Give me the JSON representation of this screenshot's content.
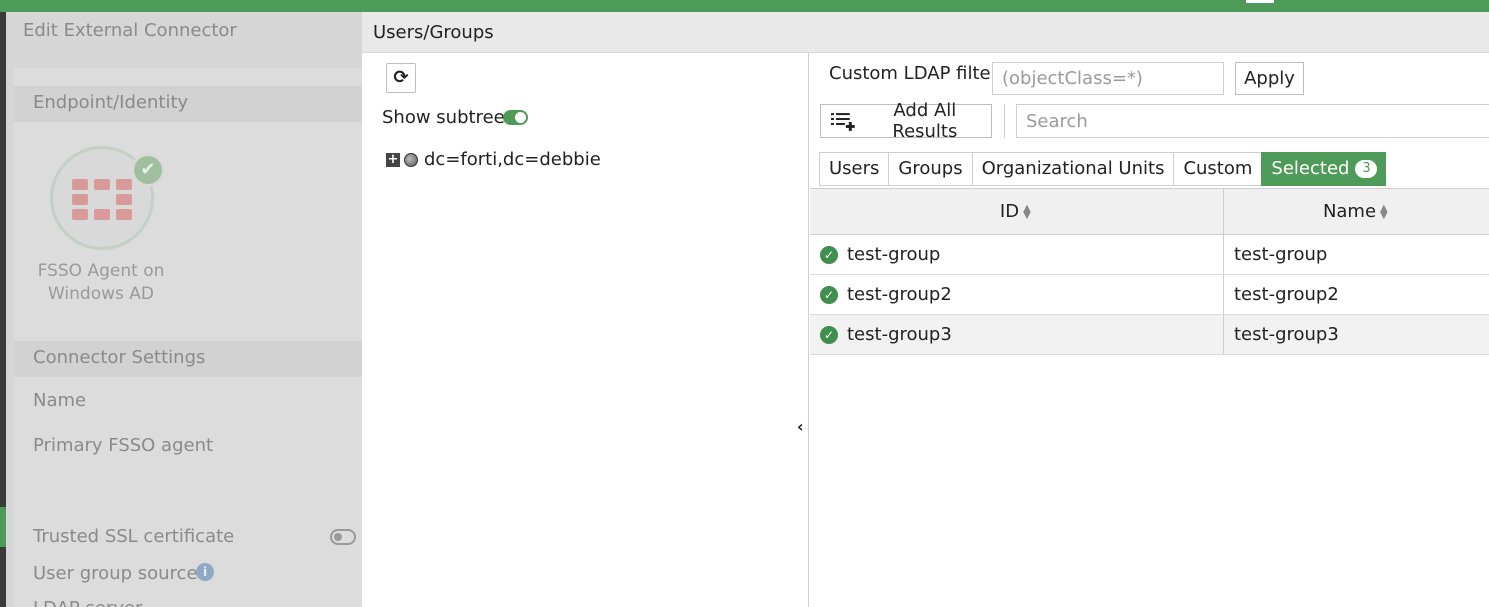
{
  "background_form": {
    "title": "Edit External Connector",
    "section_endpoint": "Endpoint/Identity",
    "connector_card_label": "FSSO Agent on Windows AD",
    "section_settings": "Connector Settings",
    "field_name": "Name",
    "field_primary_agent": "Primary FSSO agent",
    "field_trusted_ssl": "Trusted SSL certificate",
    "field_user_group_source": "User group source",
    "field_ldap_server": "LDAP server"
  },
  "dialog": {
    "title": "Users/Groups",
    "tree": {
      "show_subtree_label": "Show subtree",
      "show_subtree_on": true,
      "root_node": "dc=forti,dc=debbie"
    },
    "filter": {
      "label": "Custom LDAP filter",
      "placeholder": "(objectClass=*)",
      "apply_label": "Apply"
    },
    "add_all_label": "Add All Results",
    "search_placeholder": "Search",
    "tabs": [
      {
        "label": "Users"
      },
      {
        "label": "Groups"
      },
      {
        "label": "Organizational Units"
      },
      {
        "label": "Custom"
      },
      {
        "label": "Selected",
        "count": "3",
        "active": true
      }
    ],
    "table": {
      "columns": [
        "ID",
        "Name"
      ],
      "rows": [
        {
          "id": "test-group",
          "name": "test-group"
        },
        {
          "id": "test-group2",
          "name": "test-group2"
        },
        {
          "id": "test-group3",
          "name": "test-group3"
        }
      ]
    }
  },
  "colors": {
    "accent_green": "#4e9a58"
  },
  "icons": [
    "refresh-icon",
    "expand-plus-icon",
    "globe-icon",
    "add-list-icon",
    "sort-icon",
    "check-circle-icon",
    "chevron-left-icon",
    "info-icon"
  ]
}
